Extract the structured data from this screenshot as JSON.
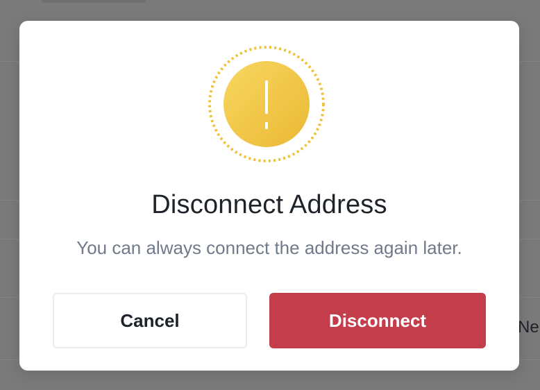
{
  "background": {
    "peek_text": "Ne"
  },
  "dialog": {
    "icon": "exclamation-warning-icon",
    "icon_color": "#f0c23a",
    "title": "Disconnect Address",
    "message": "You can always connect the address again later.",
    "cancel_label": "Cancel",
    "confirm_label": "Disconnect",
    "confirm_color": "#c33d4b"
  }
}
